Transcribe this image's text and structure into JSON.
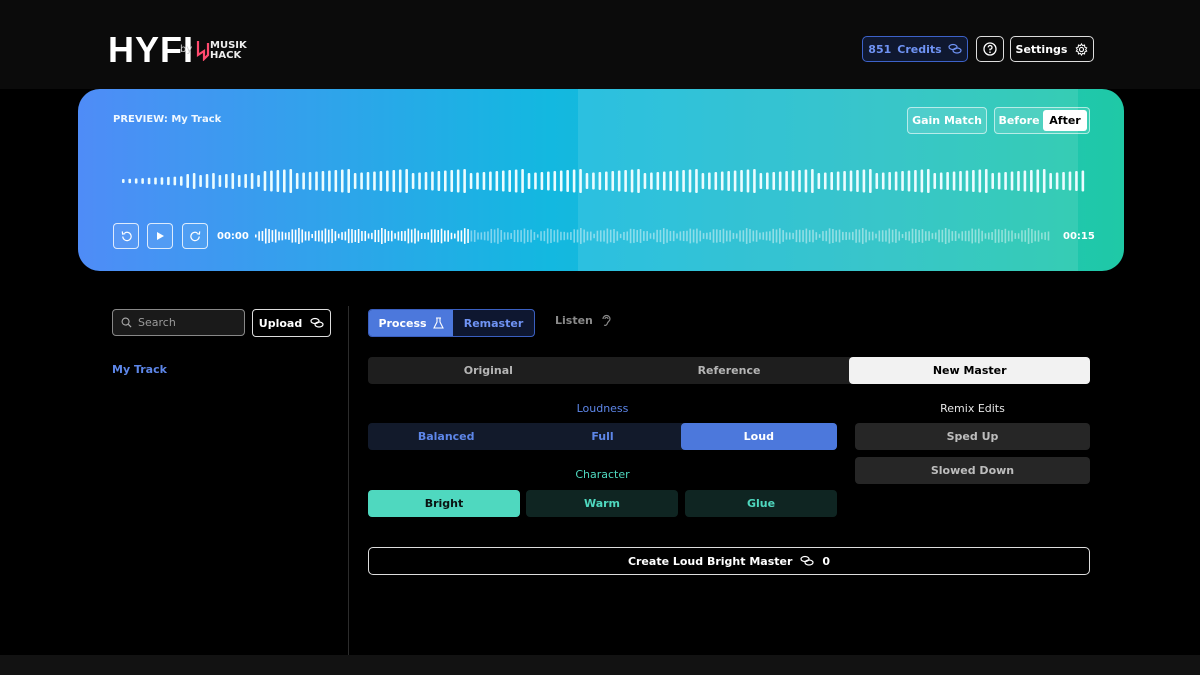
{
  "header": {
    "logo": "HYFI",
    "by": "by",
    "partner_logo": "MUSIK HACK",
    "credits_count": "851",
    "credits_label": "Credits",
    "settings_label": "Settings"
  },
  "preview": {
    "title": "PREVIEW: My Track",
    "gain_match_label": "Gain Match",
    "before_label": "Before",
    "after_label": "After",
    "current_time": "00:00",
    "total_time": "00:15",
    "playback_progress": 0.27
  },
  "sidebar": {
    "search_placeholder": "Search",
    "upload_label": "Upload",
    "tracks": [
      "My Track"
    ]
  },
  "mode_tabs": {
    "process_label": "Process",
    "remaster_label": "Remaster",
    "listen_label": "Listen"
  },
  "view_segments": {
    "items": [
      "Original",
      "Reference",
      "New Master"
    ],
    "selected": "New Master"
  },
  "loudness": {
    "heading": "Loudness",
    "options": [
      "Balanced",
      "Full",
      "Loud"
    ],
    "selected": "Loud"
  },
  "character": {
    "heading": "Character",
    "options": [
      "Bright",
      "Warm",
      "Glue"
    ],
    "selected": "Bright"
  },
  "remix": {
    "heading": "Remix Edits",
    "options": [
      "Sped Up",
      "Slowed Down"
    ]
  },
  "create": {
    "label": "Create Loud Bright Master",
    "cost": "0"
  },
  "colors": {
    "accent_blue": "#4c78dc",
    "accent_teal": "#4fd8bf",
    "preview_gradient_start": "#4f8cf7",
    "preview_gradient_end": "#22c8a8"
  },
  "icons": [
    "coins-icon",
    "question-icon",
    "gear-icon",
    "rewind-icon",
    "play-icon",
    "forward-icon",
    "search-icon",
    "flask-icon",
    "ear-icon"
  ]
}
